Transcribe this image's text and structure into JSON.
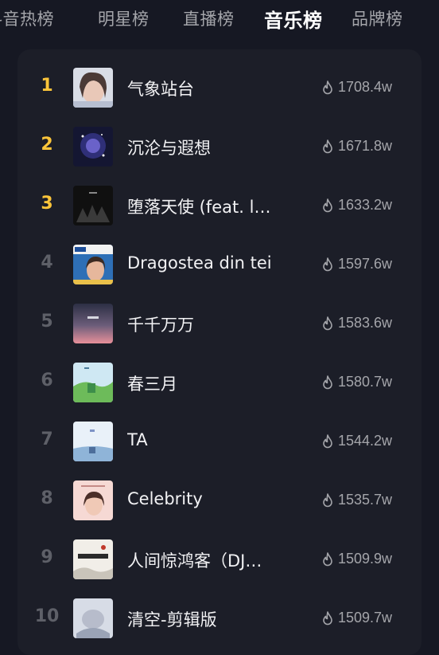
{
  "tabs": [
    {
      "label": "抖音热榜",
      "active": false
    },
    {
      "label": "明星榜",
      "active": false
    },
    {
      "label": "直播榜",
      "active": false
    },
    {
      "label": "音乐榜",
      "active": true
    },
    {
      "label": "品牌榜",
      "active": false
    }
  ],
  "colors": {
    "background": "#161823",
    "panel": "#1c1e28",
    "top_rank": "#fcc53a",
    "rank": "#5e6068",
    "muted_text": "#a4a5aa"
  },
  "songs": [
    {
      "rank": "1",
      "title": "气象站台",
      "heat": "1708.4w",
      "icon": "flame-icon"
    },
    {
      "rank": "2",
      "title": "沉沦与遐想",
      "heat": "1671.8w",
      "icon": "flame-icon"
    },
    {
      "rank": "3",
      "title": "堕落天使 (feat. l…",
      "heat": "1633.2w",
      "icon": "flame-icon"
    },
    {
      "rank": "4",
      "title": "Dragostea din tei",
      "heat": "1597.6w",
      "icon": "flame-icon"
    },
    {
      "rank": "5",
      "title": "千千万万",
      "heat": "1583.6w",
      "icon": "flame-icon"
    },
    {
      "rank": "6",
      "title": "春三月",
      "heat": "1580.7w",
      "icon": "flame-icon"
    },
    {
      "rank": "7",
      "title": "TA",
      "heat": "1544.2w",
      "icon": "flame-icon"
    },
    {
      "rank": "8",
      "title": "Celebrity",
      "heat": "1535.7w",
      "icon": "flame-icon"
    },
    {
      "rank": "9",
      "title": "人间惊鸿客（DJ…",
      "heat": "1509.9w",
      "icon": "flame-icon"
    },
    {
      "rank": "10",
      "title": "清空-剪辑版",
      "heat": "1509.7w",
      "icon": "flame-icon"
    }
  ]
}
